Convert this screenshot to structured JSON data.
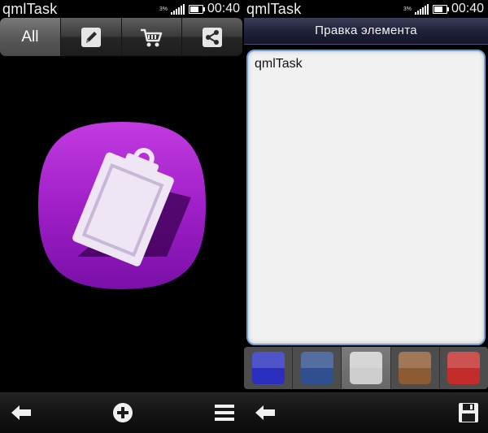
{
  "left_screen": {
    "status": {
      "app_title": "qmlTask",
      "battery_percent": "3%",
      "time": "00:40",
      "battery_level": 0.7
    },
    "toolbar": {
      "all_label": "All",
      "icons": [
        "edit-icon",
        "cart-icon",
        "share-icon"
      ]
    },
    "app_icon": {
      "name": "clipboard-icon",
      "color": "#a020c8"
    },
    "bottom_bar": {
      "icons": [
        "back-arrow-icon",
        "add-icon",
        "menu-icon"
      ]
    }
  },
  "right_screen": {
    "status": {
      "app_title": "qmlTask",
      "battery_percent": "3%",
      "time": "00:40",
      "battery_level": 0.7
    },
    "header": {
      "title": "Правка элемента"
    },
    "editor": {
      "value": "qmlTask"
    },
    "color_swatches": [
      {
        "name": "blue",
        "color": "#2a2fc0",
        "selected": false
      },
      {
        "name": "steel-blue",
        "color": "#2f4f8e",
        "selected": false
      },
      {
        "name": "light-gray",
        "color": "#cdcdcd",
        "selected": true
      },
      {
        "name": "brown",
        "color": "#8c5a33",
        "selected": false
      },
      {
        "name": "red",
        "color": "#c42c2c",
        "selected": false
      }
    ],
    "bottom_bar": {
      "icons": [
        "back-arrow-icon",
        "save-icon"
      ]
    }
  }
}
